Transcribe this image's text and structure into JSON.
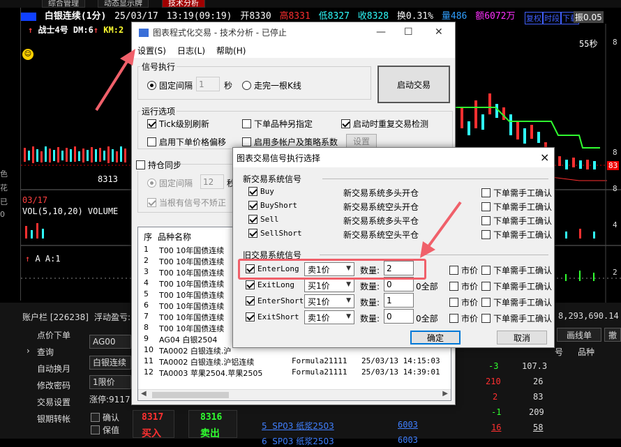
{
  "top_tabs": [
    "综合管理",
    "动态显示牌",
    "技术分析"
  ],
  "quote": {
    "name": "白银连续(1分)",
    "date": "25/03/17",
    "time": "13:19(09:19)",
    "open": "开8330",
    "high": "高8331",
    "low": "低8327",
    "close": "收8328",
    "change": "换0.31%",
    "volume": "量486",
    "amount": "额6072万",
    "tag1": "复权",
    "tag2": "时段",
    "tag3": "下载",
    "right_text": "振0.05"
  },
  "chart": {
    "indicator_line": "战士4号 DM:6",
    "km": "KM:2",
    "countdown": "55秒",
    "price_mark": "8313",
    "date_label": "03/17",
    "vol_line": "VOL(5,10,20) VOLUME",
    "a_line": "A A:1",
    "right_labels": [
      "8",
      "8",
      "8",
      "4",
      "2"
    ],
    "price_tag": "83"
  },
  "left_bar": [
    "色",
    "花",
    "已",
    "0"
  ],
  "main_window": {
    "title": "图表程式化交易 - 技术分析 - 已停止",
    "menu": [
      "设置(S)",
      "日志(L)",
      "帮助(H)"
    ],
    "signal_group": "信号执行",
    "fixed_interval": "固定间隔",
    "interval_value": "1",
    "seconds": "秒",
    "bar_complete": "走完一根K线",
    "start_button": "启动交易",
    "run_group": "运行选项",
    "tick_refresh": "Tick级别刷新",
    "order_other": "下单品种另指定",
    "restart_check": "启动时重复交易检测",
    "price_offset": "启用下单价格偏移",
    "multi_account": "启用多帐户及策略系数",
    "settings_button": "设置",
    "position_sync": "持仓同步",
    "sync_interval_label": "固定间隔",
    "sync_interval_value": "12",
    "sync_seconds": "秒",
    "no_correct": "当根有信号不矫正",
    "list_headers": [
      "序",
      "品种名称"
    ],
    "rows": [
      {
        "no": "1",
        "name": "T00 10年国债连续",
        "formula": "",
        "time": ""
      },
      {
        "no": "2",
        "name": "T00 10年国债连续",
        "formula": "",
        "time": ""
      },
      {
        "no": "3",
        "name": "T00 10年国债连续",
        "formula": "",
        "time": ""
      },
      {
        "no": "4",
        "name": "T00 10年国债连续",
        "formula": "",
        "time": ""
      },
      {
        "no": "5",
        "name": "T00 10年国债连续",
        "formula": "",
        "time": ""
      },
      {
        "no": "6",
        "name": "T00 10年国债连续",
        "formula": "",
        "time": ""
      },
      {
        "no": "7",
        "name": "T00 10年国债连续",
        "formula": "",
        "time": ""
      },
      {
        "no": "8",
        "name": "T00 10年国债连续",
        "formula": "",
        "time": ""
      },
      {
        "no": "9",
        "name": "AG04 白银2504",
        "formula": "",
        "time": ""
      },
      {
        "no": "10",
        "name": "TA0002 白银连续.沪",
        "formula": "",
        "time": ""
      },
      {
        "no": "11",
        "name": "TA0002 白银连续.沪铝连续",
        "formula": "Formula21111",
        "time": "25/03/13 14:15:03"
      },
      {
        "no": "12",
        "name": "TA0003 苹果2504.苹果2505",
        "formula": "Formula21111",
        "time": "25/03/13 14:39:01"
      }
    ]
  },
  "dialog": {
    "title": "图表交易信号执行选择",
    "close": "×",
    "new_section": "新交易系统信号",
    "new_signals": [
      {
        "name": "Buy",
        "desc": "新交易系统多头开仓",
        "manual": "下单需手工确认"
      },
      {
        "name": "BuyShort",
        "desc": "新交易系统空头开仓",
        "manual": "下单需手工确认"
      },
      {
        "name": "Sell",
        "desc": "新交易系统多头平仓",
        "manual": "下单需手工确认"
      },
      {
        "name": "SellShort",
        "desc": "新交易系统空头平仓",
        "manual": "下单需手工确认"
      }
    ],
    "old_section": "旧交易系统信号",
    "qty_label": "数量:",
    "market": "市价",
    "all": "0全部",
    "old_signals": [
      {
        "name": "EnterLong",
        "price": "卖1价",
        "qty": "2",
        "all": "",
        "manual": "下单需手工确认"
      },
      {
        "name": "ExitLong",
        "price": "买1价",
        "qty": "0",
        "all": "0全部",
        "manual": "下单需手工确认"
      },
      {
        "name": "EnterShort",
        "price": "买1价",
        "qty": "1",
        "all": "",
        "manual": "下单需手工确认"
      },
      {
        "name": "ExitShort",
        "price": "卖1价",
        "qty": "0",
        "all": "0全部",
        "manual": "下单需手工确认"
      }
    ],
    "ok": "确定",
    "cancel": "取消"
  },
  "bottom": {
    "account_label": "账户栏 [226238]",
    "float_label": "浮动盈亏:",
    "balance": "8,293,690.14",
    "side_menu": [
      "点价下单",
      "查询",
      "自动换月",
      "修改密码",
      "交易设置",
      "银期转帐"
    ],
    "code_input": "AG00",
    "name_input": "白银连续",
    "price_type": "1限价",
    "limit_up": "涨停:9117",
    "confirm": "确认",
    "keep": "保值",
    "buy_price": "8317",
    "sell_price": "8316",
    "buy_label": "买入",
    "sell_label": "卖出",
    "line_order": "画线单",
    "withdraw": "撤",
    "col_no": "号",
    "col_kind": "品种",
    "right_values": [
      {
        "a": "-3",
        "b": "107.3"
      },
      {
        "a": "210",
        "b": "26"
      },
      {
        "a": "2",
        "b": "83"
      },
      {
        "a": "-1",
        "b": "209"
      },
      {
        "a": "16",
        "b": "58"
      }
    ],
    "bottom_rows": [
      {
        "no": "5",
        "name": "SP03 纸浆2503",
        "val": "6003"
      },
      {
        "no": "6",
        "name": "SP03 纸浆2503",
        "val": "6003"
      }
    ]
  }
}
